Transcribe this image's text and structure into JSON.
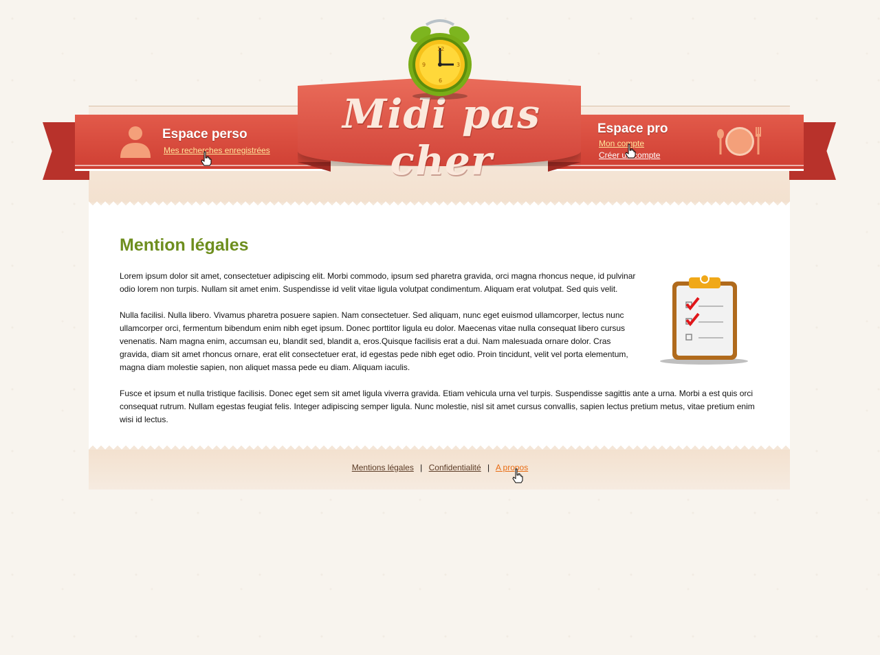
{
  "header": {
    "logo_text": "Midi pas cher",
    "espace_perso": {
      "title": "Espace perso",
      "link": "Mes recherches enregistrées"
    },
    "espace_pro": {
      "title": "Espace pro",
      "link_account": "Mon compte",
      "link_create": "Créer un compte"
    }
  },
  "main": {
    "title": "Mention légales",
    "paragraphs": [
      "Lorem ipsum dolor sit amet, consectetuer adipiscing elit. Morbi commodo, ipsum sed pharetra gravida, orci magna rhoncus neque, id pulvinar odio lorem non turpis. Nullam sit amet enim. Suspendisse id velit vitae ligula volutpat condimentum. Aliquam erat volutpat. Sed quis velit.",
      "Nulla facilisi. Nulla libero. Vivamus pharetra posuere sapien. Nam consectetuer. Sed aliquam, nunc eget euismod ullamcorper, lectus nunc ullamcorper orci, fermentum bibendum enim nibh eget ipsum. Donec porttitor ligula eu dolor. Maecenas vitae nulla consequat libero cursus venenatis. Nam magna enim, accumsan eu, blandit sed, blandit a, eros.Quisque facilisis erat a dui. Nam malesuada ornare dolor. Cras gravida, diam sit amet rhoncus ornare, erat elit consectetuer erat, id egestas pede nibh eget odio. Proin tincidunt, velit vel porta elementum, magna diam molestie sapien, non aliquet massa pede eu diam. Aliquam iaculis.",
      "Fusce et ipsum et nulla tristique facilisis. Donec eget sem sit amet ligula viverra gravida. Etiam vehicula urna vel turpis. Suspendisse sagittis ante a urna. Morbi a est quis orci consequat rutrum. Nullam egestas feugiat felis. Integer adipiscing semper ligula. Nunc molestie, nisl sit amet cursus convallis, sapien lectus pretium metus, vitae pretium enim wisi id lectus."
    ]
  },
  "footer": {
    "links": [
      "Mentions légales",
      "Confidentialité",
      "A propos"
    ],
    "separator": "|"
  },
  "colors": {
    "ribbon": "#d2453a",
    "title_green": "#6e8e1e",
    "active_link": "#e86b12"
  },
  "icons": [
    "alarm-clock-icon",
    "user-icon",
    "plate-cutlery-icon",
    "clipboard-checklist-icon",
    "hand-cursor-icon"
  ]
}
